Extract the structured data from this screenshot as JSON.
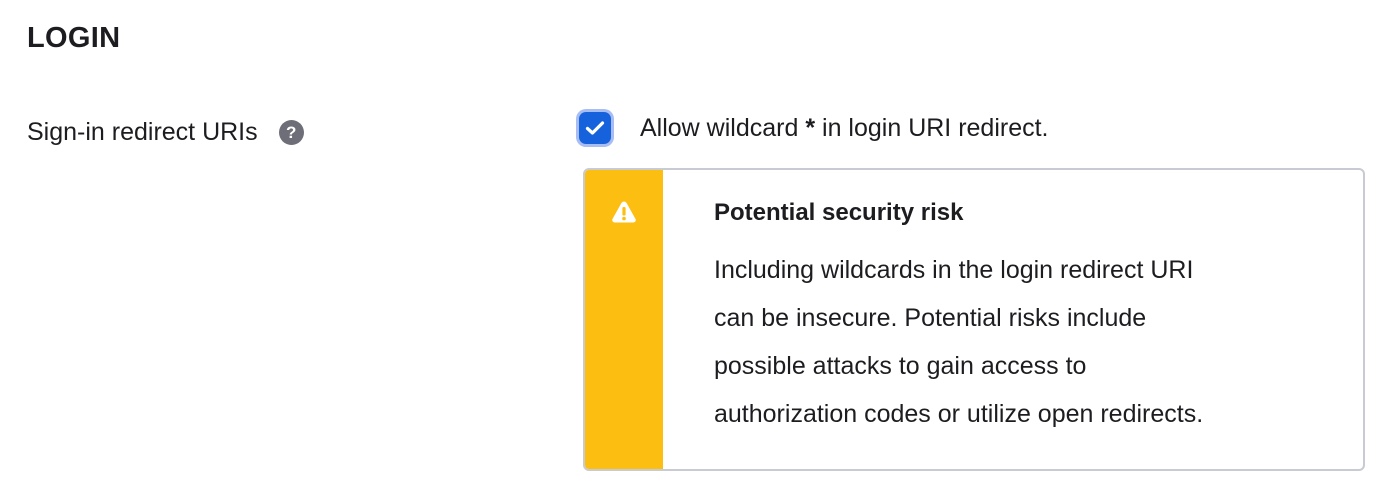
{
  "section": {
    "title": "LOGIN"
  },
  "field": {
    "label": "Sign-in redirect URIs",
    "help_icon": "question-mark-icon",
    "help_glyph": "?"
  },
  "wildcard_option": {
    "checked": true,
    "label_before": "Allow wildcard ",
    "label_symbol": "*",
    "label_after": " in login URI redirect.",
    "check_icon": "checkmark-icon"
  },
  "callout": {
    "icon": "warning-icon",
    "title": "Potential security risk",
    "lines": [
      "Including wildcards in the login redirect URI",
      "can be insecure. Potential risks include",
      "possible attacks to gain access to",
      "authorization codes or utilize open redirects."
    ]
  },
  "colors": {
    "checkbox": "#1662dd",
    "checkbox_focus_ring": "#a8bdf4",
    "warning_stripe": "#fdbe12",
    "help_icon": "#6e6e78",
    "callout_border": "#c9cbd2"
  }
}
